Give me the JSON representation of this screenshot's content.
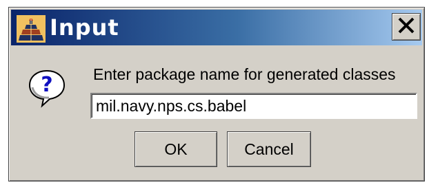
{
  "window": {
    "title": "Input",
    "icons": {
      "app": "java-cup-icon",
      "close": "close-icon"
    }
  },
  "message": {
    "icon": "question-icon",
    "prompt": "Enter package name for generated classes"
  },
  "input": {
    "value": "mil.navy.nps.cs.babel"
  },
  "buttons": {
    "ok_label": "OK",
    "cancel_label": "Cancel"
  },
  "colors": {
    "dialog_bg": "#d4d0c8",
    "titlebar_start": "#0a246a",
    "titlebar_end": "#a6caf0",
    "title_text": "#ffffff"
  }
}
